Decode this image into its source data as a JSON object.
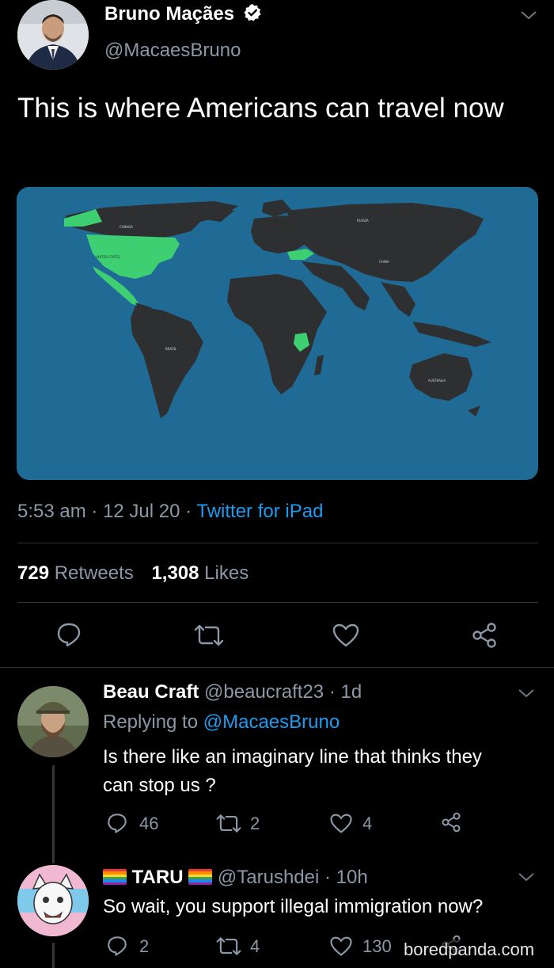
{
  "tweet": {
    "author": {
      "name": "Bruno Maçães",
      "handle": "@MacaesBruno",
      "verified": true
    },
    "text": "This is where Americans can travel now",
    "map": {
      "labels": {
        "canada": "CANADA",
        "united_states": "UNITED STATES",
        "russia": "RUSSIA",
        "china": "CHINA",
        "brazil": "BRAZIL",
        "australia": "AUSTRALIA"
      },
      "ocean_color": "#1f6b96",
      "land_color": "#2e2f31",
      "highlight_color": "#3ecf72"
    },
    "time": "5:53 am",
    "date": "12 Jul 20",
    "sep1": "·",
    "sep2": "·",
    "source": "Twitter for iPad",
    "retweets": {
      "count": "729",
      "label": "Retweets"
    },
    "likes": {
      "count": "1,308",
      "label": "Likes"
    }
  },
  "replies": [
    {
      "name": "Beau Craft",
      "handle": "@beaucraft23",
      "sep": "·",
      "time": "1d",
      "replying_label": "Replying to",
      "replying_to": "@MacaesBruno",
      "text_line1": "Is there like an imaginary line that thinks they",
      "text_line2": "can stop us ?",
      "replies": "46",
      "retweets": "2",
      "likes": "4"
    },
    {
      "name": "TARU",
      "handle": "@Tarushdei",
      "sep": "·",
      "time": "10h",
      "text": "So wait, you support illegal immigration now?",
      "replies": "2",
      "retweets": "4",
      "likes": "130"
    }
  ],
  "watermark": "boredpanda.com",
  "icons": [
    "verified-badge-icon",
    "chevron-down-icon",
    "reply-icon",
    "retweet-icon",
    "like-icon",
    "share-icon",
    "rainbow-flag-icon"
  ]
}
